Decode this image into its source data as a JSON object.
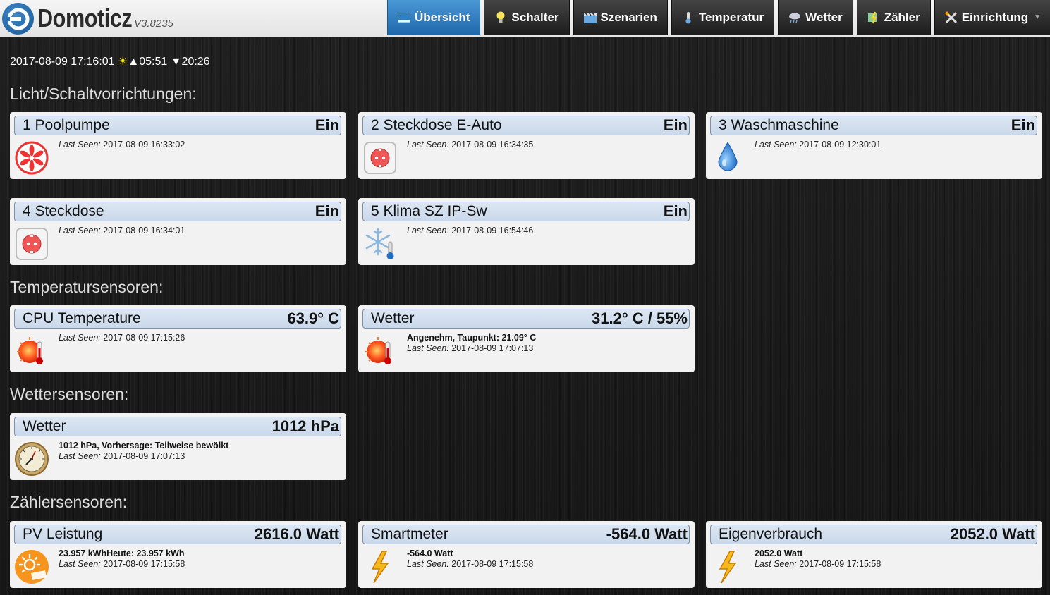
{
  "app": {
    "name": "Domoticz",
    "version": "V3.8235",
    "brand_color": "#2a73b5"
  },
  "nav": [
    {
      "label": "Übersicht",
      "icon": "dashboard-icon",
      "active": true
    },
    {
      "label": "Schalter",
      "icon": "lightbulb-icon"
    },
    {
      "label": "Szenarien",
      "icon": "clapperboard-icon"
    },
    {
      "label": "Temperatur",
      "icon": "thermometer-icon"
    },
    {
      "label": "Wetter",
      "icon": "cloud-rain-icon"
    },
    {
      "label": "Zähler",
      "icon": "meter-icon"
    },
    {
      "label": "Einrichtung",
      "icon": "tools-icon",
      "dropdown": true
    }
  ],
  "datetime": {
    "now": "2017-08-09 17:16:01",
    "sunrise": "▲05:51",
    "sunset": "▼20:26",
    "sun_symbol": "☀"
  },
  "last_seen_label": "Last Seen:",
  "sections": {
    "switches": "Licht/Schaltvorrichtungen:",
    "temperature": "Temperatursensoren:",
    "weather": "Wettersensoren:",
    "meters": "Zählersensoren:"
  },
  "switches": [
    {
      "name": "1 Poolpumpe",
      "status": "Ein",
      "last_seen": "2017-08-09 16:33:02",
      "icon": "fan-icon"
    },
    {
      "name": "2 Steckdose E-Auto",
      "status": "Ein",
      "last_seen": "2017-08-09 16:34:35",
      "icon": "power-socket-icon"
    },
    {
      "name": "3 Waschmaschine",
      "status": "Ein",
      "last_seen": "2017-08-09 12:30:01",
      "icon": "water-drop-icon"
    },
    {
      "name": "4 Steckdose",
      "status": "Ein",
      "last_seen": "2017-08-09 16:34:01",
      "icon": "power-socket-icon"
    },
    {
      "name": "5 Klima SZ IP-Sw",
      "status": "Ein",
      "last_seen": "2017-08-09 16:54:46",
      "icon": "snowflake-icon"
    }
  ],
  "temperature": [
    {
      "name": "CPU Temperature",
      "status": "63.9° C",
      "last_seen": "2017-08-09 17:15:26",
      "icon": "hot-thermometer-icon"
    },
    {
      "name": "Wetter",
      "status": "31.2° C / 55%",
      "desc": "Angenehm, Taupunkt: 21.09° C",
      "last_seen": "2017-08-09 17:07:13",
      "icon": "hot-thermometer-icon"
    }
  ],
  "weather": [
    {
      "name": "Wetter",
      "status": "1012 hPa",
      "desc": "1012 hPa, Vorhersage: Teilweise bewölkt",
      "last_seen": "2017-08-09 17:07:13",
      "icon": "barometer-icon"
    }
  ],
  "meters": [
    {
      "name": "PV Leistung",
      "status": "2616.0 Watt",
      "desc": "23.957 kWhHeute: 23.957 kWh",
      "last_seen": "2017-08-09 17:15:58",
      "icon": "solar-icon"
    },
    {
      "name": "Smartmeter",
      "status": "-564.0 Watt",
      "desc": "-564.0 Watt",
      "last_seen": "2017-08-09 17:15:58",
      "icon": "lightning-icon"
    },
    {
      "name": "Eigenverbrauch",
      "status": "2052.0 Watt",
      "desc": "2052.0 Watt",
      "last_seen": "2017-08-09 17:15:58",
      "icon": "lightning-icon"
    }
  ]
}
